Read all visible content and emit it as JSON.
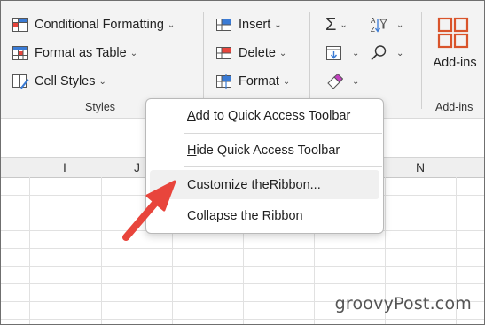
{
  "ribbon": {
    "styles": {
      "conditional_formatting": "Conditional Formatting",
      "format_as_table": "Format as Table",
      "cell_styles": "Cell Styles",
      "group_label": "Styles"
    },
    "cells": {
      "insert": "Insert",
      "delete": "Delete",
      "format": "Format"
    },
    "addins": {
      "button_label": "Add-ins",
      "group_label": "Add-ins"
    }
  },
  "sheet": {
    "columns": [
      "I",
      "J",
      "N"
    ]
  },
  "context_menu": {
    "items": [
      {
        "pre": "",
        "ul": "A",
        "post": "dd to Quick Access Toolbar"
      },
      {
        "pre": "",
        "ul": "H",
        "post": "ide Quick Access Toolbar"
      },
      {
        "pre": "Customize the ",
        "ul": "R",
        "post": "ibbon..."
      },
      {
        "pre": "Collapse the Ribbo",
        "ul": "n",
        "post": ""
      }
    ]
  },
  "watermark": "groovyPost.com",
  "colors": {
    "accent_red": "#e8453c",
    "addins_orange": "#d9542b",
    "ribbon_bg": "#f3f3f3"
  }
}
